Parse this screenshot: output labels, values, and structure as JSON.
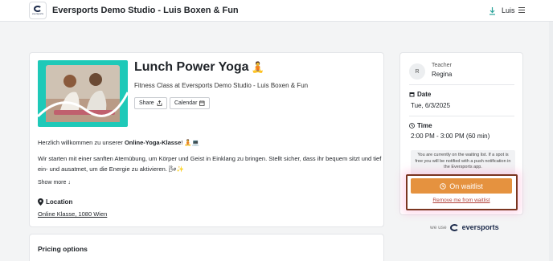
{
  "header": {
    "studio_title": "Eversports Demo Studio - Luis Boxen & Fun",
    "user_name": "Luis",
    "logo_text": "eversports"
  },
  "class": {
    "title": "Lunch Power Yoga",
    "title_emoji": "🧘",
    "subtitle": "Fitness Class at  Eversports Demo Studio - Luis Boxen & Fun",
    "share_label": "Share",
    "calendar_label": "Calendar",
    "welcome_prefix": "Herzlich willkommen zu unserer ",
    "welcome_bold": "Online-Yoga-Klasse",
    "welcome_suffix": "! 🧘💻",
    "description": "Wir starten mit einer sanften Atemübung, um Körper und Geist in Einklang zu bringen. Stellt sicher, dass ihr bequem sitzt und tief ein- und ausatmet, um die Energie zu aktivieren. 🌬✨",
    "show_more": "Show more",
    "location_heading": "Location",
    "location_link": "Online Klasse, 1080 Wien"
  },
  "pricing": {
    "heading": "Pricing options"
  },
  "sidebar": {
    "avatar_initial": "R",
    "teacher_label": "Teacher",
    "teacher_name": "Regina",
    "date_heading": "Date",
    "date_value": "Tue, 6/3/2025",
    "time_heading": "Time",
    "time_value": "2:00 PM - 3:00 PM (60 min)",
    "waitlist_note": "You are currently on the waiting list. If a spot is free you will be notified with a push notification in the Eversports app.",
    "waitlist_button": "On waitlist",
    "remove_link": "Remove me from waitlist"
  },
  "footer": {
    "we_use": "we use",
    "brand": "eversports"
  },
  "colors": {
    "accent_orange": "#e5923f",
    "teal": "#1ec9b8",
    "remove_red": "#b1413a",
    "highlight_border": "#7a3520"
  }
}
